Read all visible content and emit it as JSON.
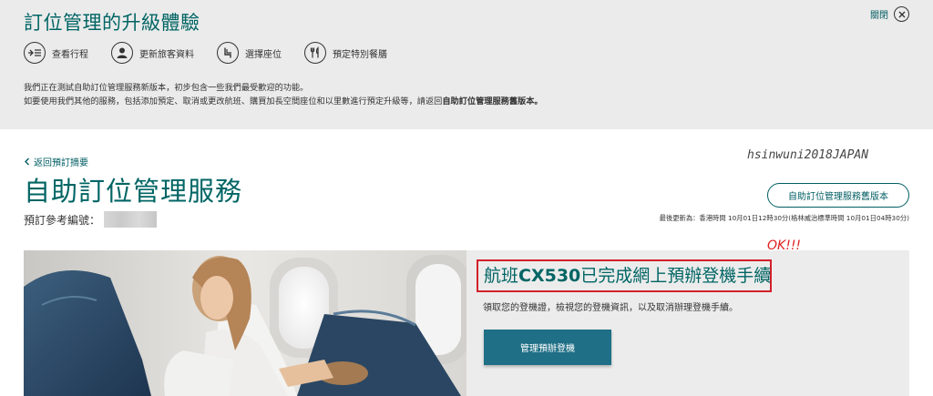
{
  "banner": {
    "title": "訂位管理的升級體驗",
    "close_label": "關閉",
    "features": [
      {
        "label": "查看行程",
        "icon": "plane-list-icon"
      },
      {
        "label": "更新旅客資料",
        "icon": "person-icon"
      },
      {
        "label": "選擇座位",
        "icon": "seat-icon"
      },
      {
        "label": "預定特別餐膳",
        "icon": "cutlery-icon"
      }
    ],
    "desc_line1": "我們正在測試自助訂位管理服務新版本，初步包含一些我們最受歡迎的功能。",
    "desc_line2_prefix": "如要使用我們其他的服務，包括添加預定、取消或更改航班、購買加長空間座位和以里數進行預定升級等，請返回",
    "desc_line2_bold": "自助訂位管理服務舊版本。"
  },
  "page": {
    "back_link": "返回預訂摘要",
    "title": "自助訂位管理服務",
    "old_version_button": "自助訂位管理服務舊版本",
    "ref_label": "預訂參考編號：",
    "last_updated": "最後更新為：香港時間 10月01日12時30分(格林威治標準時間 10月01日04時30分)",
    "watermark": "hsinwuni2018JAPAN",
    "annotation": "OK!!!"
  },
  "hero": {
    "title_prefix": "航班",
    "flight_no": "CX530",
    "title_suffix": "已完成網上預辦登機手續",
    "subtitle": "領取您的登機證，檢視您的登機資訊，以及取消辦理登機手續。",
    "cta_label": "管理預辦登機"
  },
  "colors": {
    "brand_teal": "#006564",
    "cta_blue": "#1f6f86",
    "highlight_red": "#d3202a"
  }
}
